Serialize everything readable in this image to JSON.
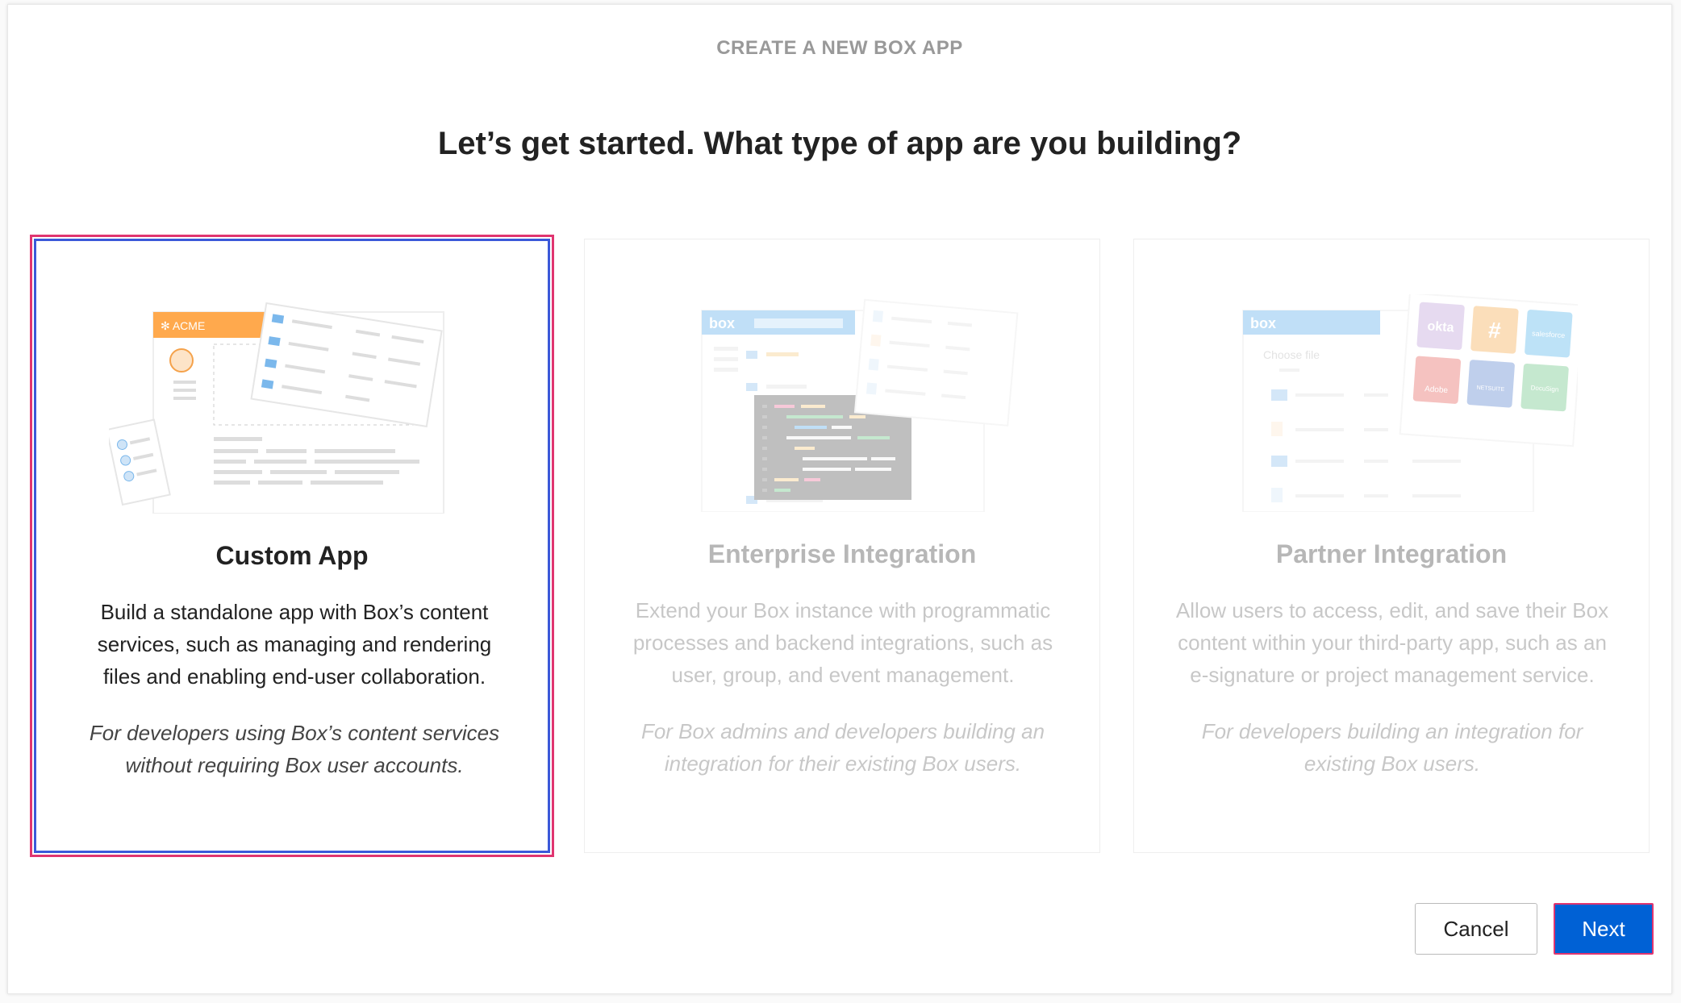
{
  "header": {
    "kicker": "CREATE A NEW BOX APP",
    "title": "Let’s get started. What type of app are you building?"
  },
  "cards": [
    {
      "title": "Custom App",
      "description": "Build a standalone app with Box’s content services, such as managing and rendering files and enabling end-user collaboration.",
      "note": "For developers using Box’s content services without requiring Box user accounts.",
      "selected": true,
      "illustration": {
        "banner_label": "✻ ACME",
        "banner_color": "#ffa94d"
      }
    },
    {
      "title": "Enterprise Integration",
      "description": "Extend your Box instance with programmatic processes and backend integrations, such as user, group, and event management.",
      "note": "For Box admins and developers building an integration for their existing Box users.",
      "selected": false,
      "illustration": {
        "banner_label": "box",
        "banner_color": "#3d9ee8"
      }
    },
    {
      "title": "Partner Integration",
      "description": "Allow users to access, edit, and save their Box content within your third-party app, such as an e-signature or project management service.",
      "note": "For developers building an integration for existing Box users.",
      "selected": false,
      "illustration": {
        "banner_label": "box",
        "banner_color": "#3d9ee8",
        "choose_file_label": "Choose file",
        "partner_tiles": [
          {
            "label": "okta",
            "color": "#b48fd1"
          },
          {
            "label": "#",
            "color": "#f39b2b"
          },
          {
            "label": "salesforce",
            "color": "#34a8e8"
          },
          {
            "label": "Adobe",
            "color": "#e2453d"
          },
          {
            "label": "NETSUITE",
            "color": "#3a6cc6"
          },
          {
            "label": "DocuSign",
            "color": "#4dbb6b"
          }
        ]
      }
    }
  ],
  "footer": {
    "cancel_label": "Cancel",
    "next_label": "Next"
  },
  "colors": {
    "accent": "#0061d5",
    "selection_border": "#3b59d9",
    "highlight": "#e03570"
  }
}
